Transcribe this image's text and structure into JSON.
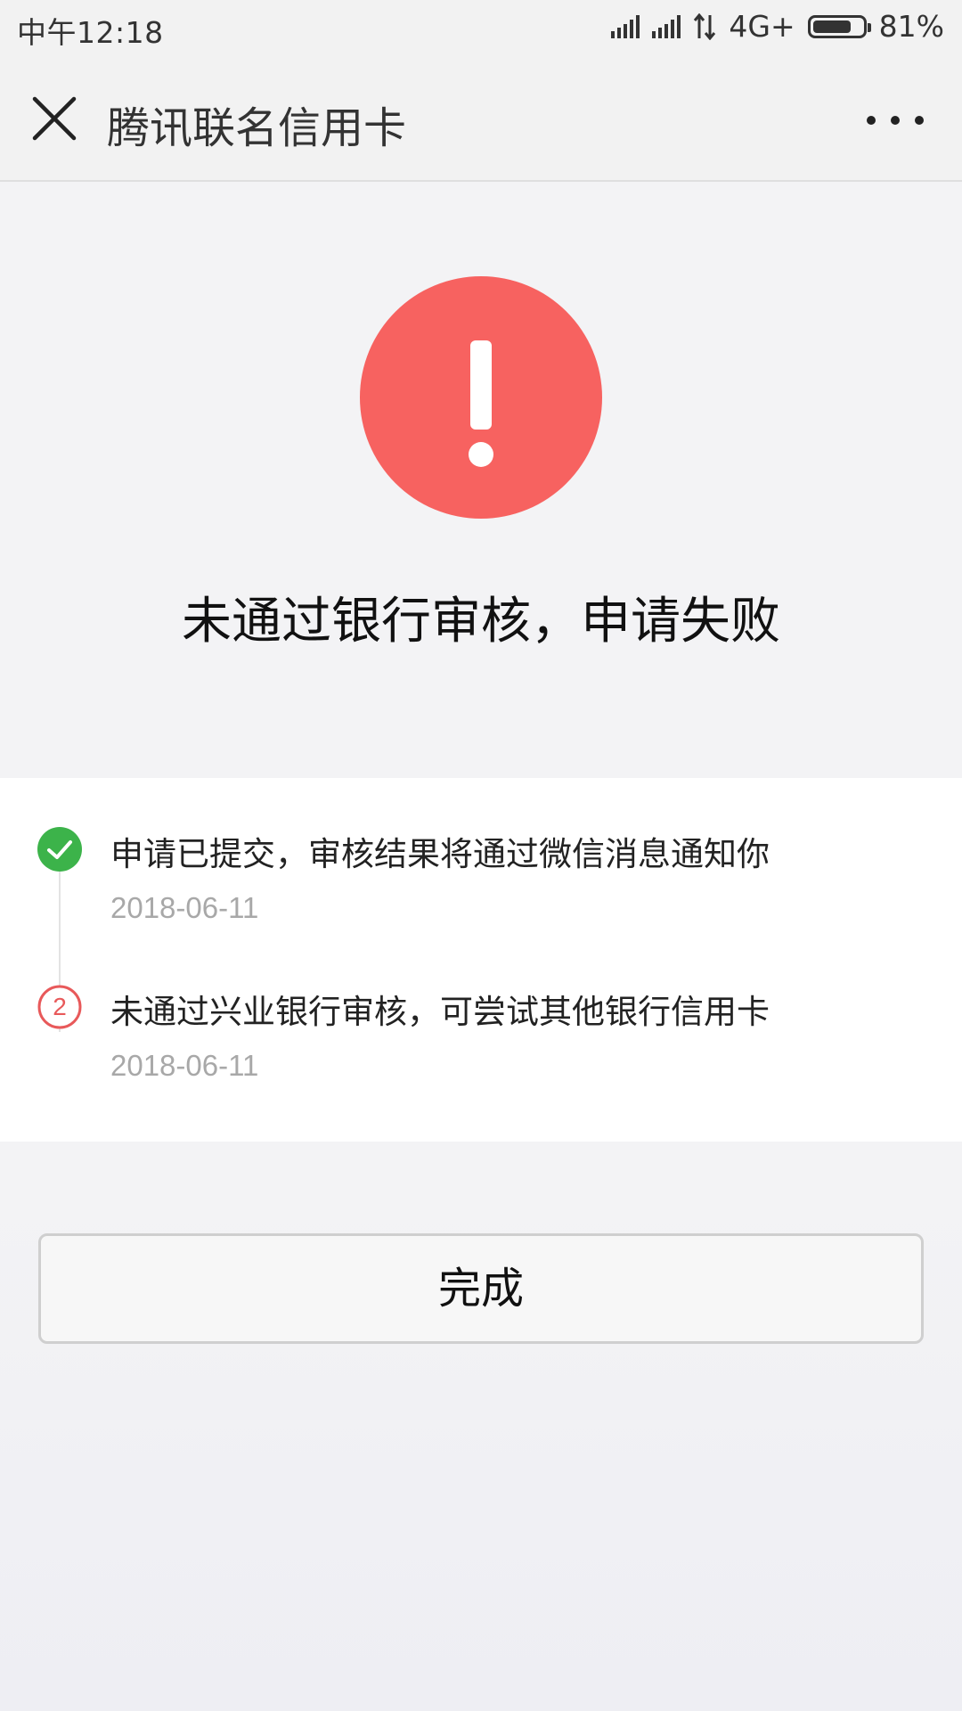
{
  "status_bar": {
    "time": "中午12:18",
    "network": "4G+",
    "battery": "81%",
    "battery_level": 0.81
  },
  "nav": {
    "title": "腾讯联名信用卡",
    "close_icon": "close-icon",
    "more_icon": "more-icon"
  },
  "result": {
    "icon": "warning-icon",
    "icon_color": "#f76260",
    "title": "未通过银行审核，申请失败"
  },
  "timeline": {
    "steps": [
      {
        "icon": "check-icon",
        "icon_color": "#3cb34a",
        "text": "申请已提交，审核结果将通过微信消息通知你",
        "date": "2018-06-11"
      },
      {
        "icon": "step-number-icon",
        "number": "2",
        "icon_color": "#e8595a",
        "text": "未通过兴业银行审核，可尝试其他银行信用卡",
        "date": "2018-06-11"
      }
    ]
  },
  "actions": {
    "done_label": "完成"
  }
}
